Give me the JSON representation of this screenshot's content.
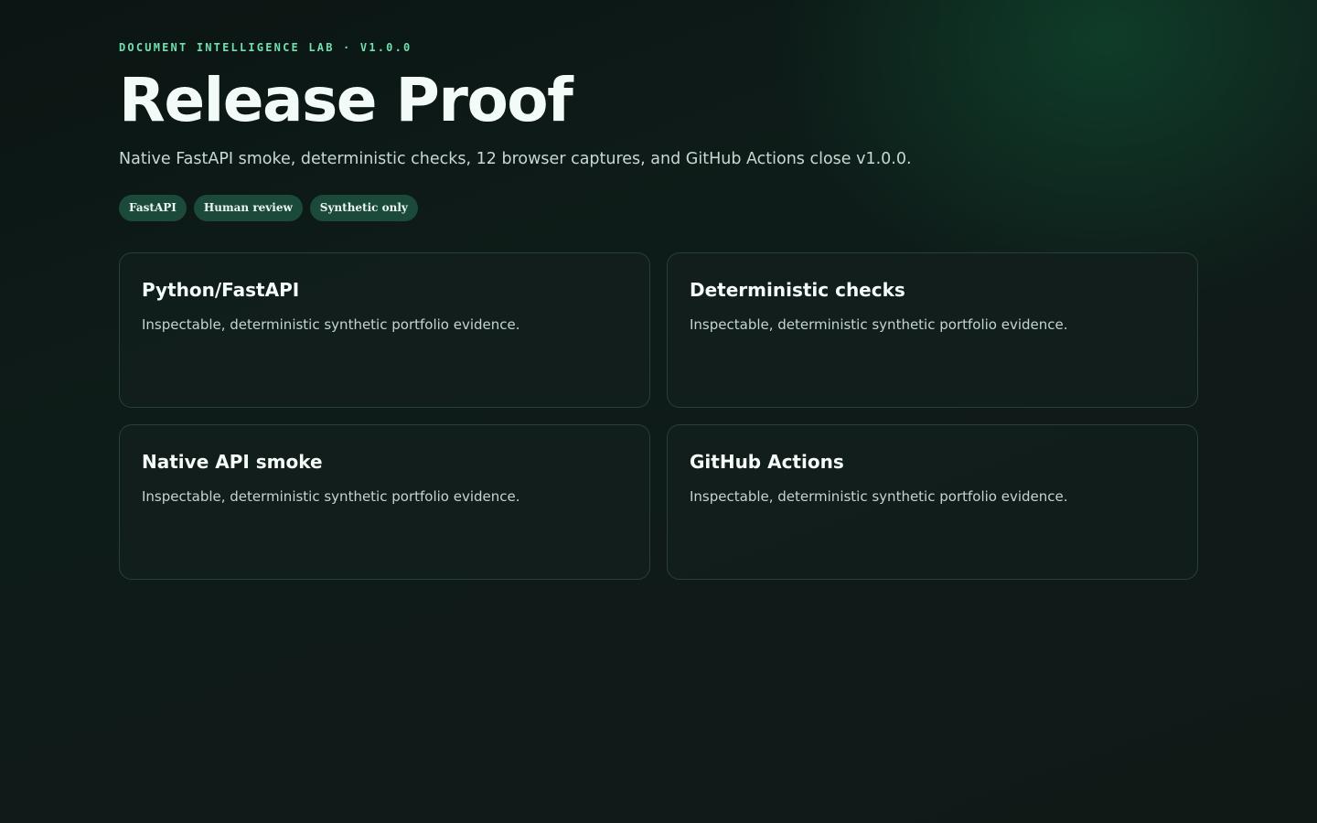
{
  "header": {
    "eyebrow": "DOCUMENT INTELLIGENCE LAB · V1.0.0",
    "title": "Release Proof",
    "subtitle": "Native FastAPI smoke, deterministic checks, 12 browser captures, and GitHub Actions close v1.0.0."
  },
  "tags": [
    {
      "label": "FastAPI"
    },
    {
      "label": "Human review"
    },
    {
      "label": "Synthetic only"
    }
  ],
  "cards": [
    {
      "title": "Python/FastAPI",
      "body": "Inspectable, deterministic synthetic portfolio evidence."
    },
    {
      "title": "Deterministic checks",
      "body": "Inspectable, deterministic synthetic portfolio evidence."
    },
    {
      "title": "Native API smoke",
      "body": "Inspectable, deterministic synthetic portfolio evidence."
    },
    {
      "title": "GitHub Actions",
      "body": "Inspectable, deterministic synthetic portfolio evidence."
    }
  ],
  "colors": {
    "accent": "#6fe0b0",
    "tag_background": "#1b4a3b",
    "card_border": "#274039",
    "background": "#0e1c19"
  }
}
